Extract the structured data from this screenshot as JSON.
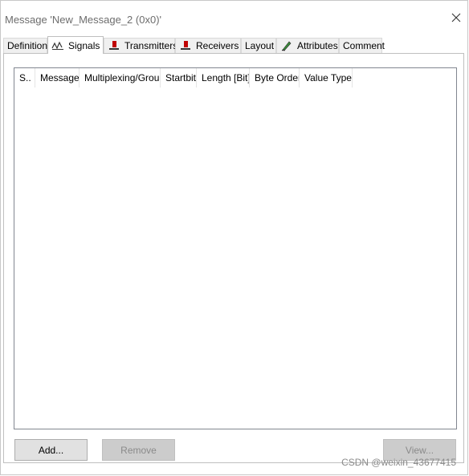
{
  "window": {
    "title": "Message 'New_Message_2 (0x0)'"
  },
  "tabs": [
    {
      "label": "Definition",
      "icon": "none"
    },
    {
      "label": "Signals",
      "icon": "signal-wave-icon",
      "active": true
    },
    {
      "label": "Transmitters",
      "icon": "transmitter-icon"
    },
    {
      "label": "Receivers",
      "icon": "receiver-icon"
    },
    {
      "label": "Layout",
      "icon": "none"
    },
    {
      "label": "Attributes",
      "icon": "attributes-pen-icon"
    },
    {
      "label": "Comment",
      "icon": "none"
    }
  ],
  "table": {
    "columns": [
      "S..",
      "Message",
      "Multiplexing/Group",
      "Startbit",
      "Length [Bit]",
      "Byte Order",
      "Value Type"
    ],
    "rows": []
  },
  "buttons": {
    "add": "Add...",
    "remove": "Remove",
    "view": "View..."
  },
  "watermark": "CSDN @weixin_43677415",
  "colors": {
    "icon_red": "#c00000",
    "disabled_button": "#cccccc",
    "active_tab": "#ffffff",
    "inactive_tab": "#f0f0f0"
  }
}
